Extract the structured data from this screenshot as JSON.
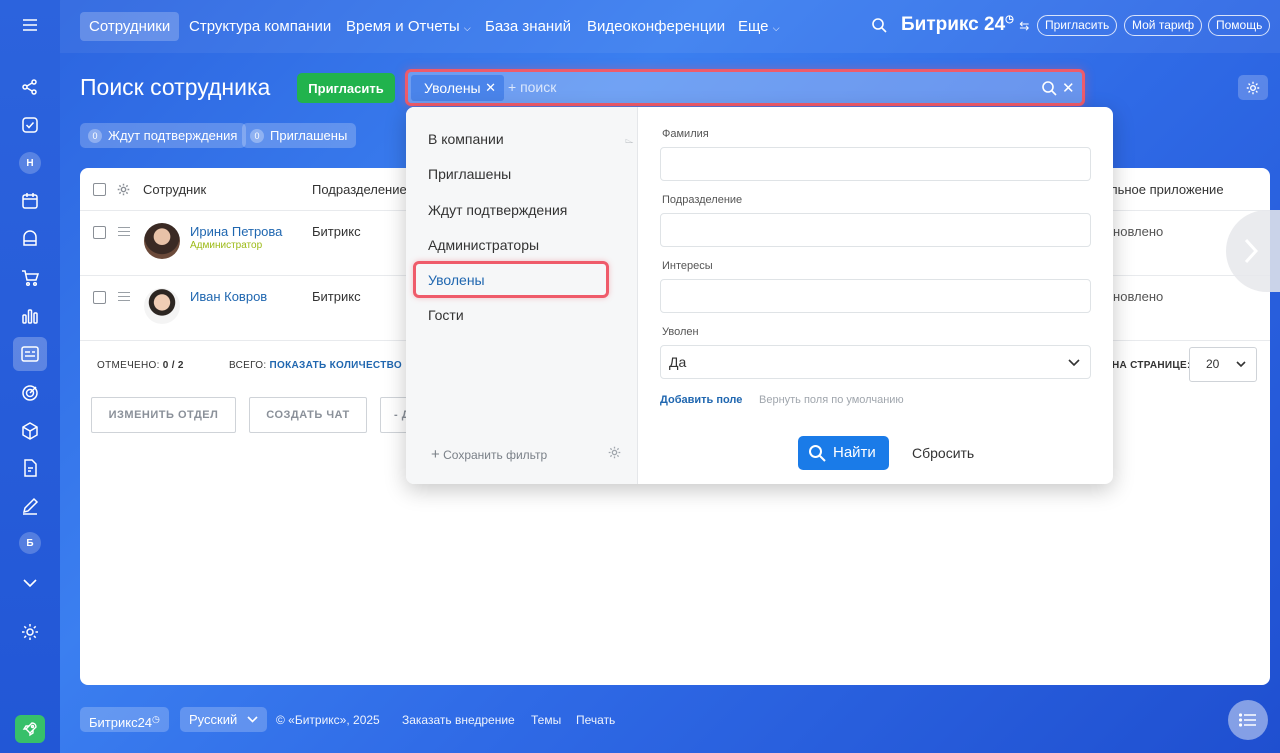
{
  "nav": {
    "items": [
      "Сотрудники",
      "Структура компании",
      "Время и Отчеты",
      "База знаний",
      "Видеоконференции",
      "Еще"
    ],
    "logo": "Битрикс 24",
    "invite": "Пригласить",
    "tariff": "Мой тариф",
    "help": "Помощь"
  },
  "page": {
    "title": "Поиск сотрудника",
    "invite_button": "Пригласить"
  },
  "search": {
    "chip": "Уволены",
    "placeholder": "+ поиск"
  },
  "counters": [
    {
      "count": "0",
      "label": "Ждут подтверждения"
    },
    {
      "count": "0",
      "label": "Приглашены"
    }
  ],
  "table": {
    "headers": {
      "employee": "Сотрудник",
      "department": "Подразделение",
      "app": "льное приложение"
    },
    "rows": [
      {
        "name": "Ирина Петрова",
        "role": "Администратор",
        "department": "Битрикс",
        "status": "тановлено"
      },
      {
        "name": "Иван Ковров",
        "role": "",
        "department": "Битрикс",
        "status": "тановлено"
      }
    ],
    "marked_label": "ОТМЕЧЕНО:",
    "marked_value": "0 / 2",
    "total_label": "ВСЕГО:",
    "total_link": "ПОКАЗАТЬ КОЛИЧЕСТВО",
    "per_page_label": "НА СТРАНИЦЕ:",
    "per_page_value": "20",
    "actions": [
      "ИЗМЕНИТЬ ОТДЕЛ",
      "СОЗДАТЬ ЧАТ",
      "- Д"
    ]
  },
  "filter": {
    "presets": [
      "В компании",
      "Приглашены",
      "Ждут подтверждения",
      "Администраторы",
      "Уволены",
      "Гости"
    ],
    "active_preset": "Уволены",
    "save_filter": "Сохранить фильтр",
    "fields": {
      "last_name": "Фамилия",
      "department": "Подразделение",
      "interests": "Интересы",
      "fired": "Уволен",
      "fired_value": "Да"
    },
    "add_field": "Добавить поле",
    "restore_fields": "Вернуть поля по умолчанию",
    "find": "Найти",
    "reset": "Сбросить"
  },
  "sidebar": {
    "letter_1": "Н",
    "letter_2": "Б"
  },
  "footer": {
    "brand": "Битрикс24",
    "language": "Русский",
    "copyright": "© «Битрикс», 2025",
    "order": "Заказать внедрение",
    "themes": "Темы",
    "print": "Печать"
  },
  "colors": {
    "accent": "#2067b0",
    "invite_green": "#21b34d",
    "highlight": "#ef5b6a",
    "find_blue": "#1a7be8"
  }
}
